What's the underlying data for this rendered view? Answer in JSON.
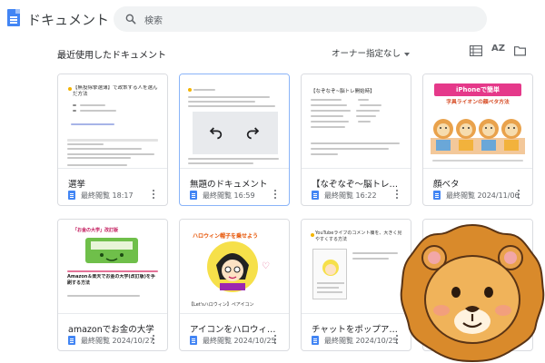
{
  "app": {
    "title": "ドキュメント"
  },
  "search": {
    "placeholder": "検索"
  },
  "section": {
    "title": "最近使用したドキュメント"
  },
  "filter": {
    "owner": "オーナー指定なし"
  },
  "toolbar": {
    "sort_label": "AZ"
  },
  "colors": {
    "accent": "#4285f4",
    "selected_border": "#8ab4f8",
    "text": "#202124",
    "muted": "#5f6368"
  },
  "documents": [
    {
      "title": "選挙",
      "date": "最終閲覧 18:17",
      "thumb_title": "【無投除挙選薄】で政策する人を選んだ方法"
    },
    {
      "title": "無題のドキュメント",
      "date": "最終閲覧 16:59",
      "thumb_title": "無題のドキュメント"
    },
    {
      "title": "【なぞなぞ〜脳トレ開始時…",
      "date": "最終閲覧 16:22",
      "thumb_title": "【なぞなぞ~脳トレ開始時】"
    },
    {
      "title": "顔ベタ",
      "date": "最終閲覧 2024/11/06",
      "thumb_title": "iPhoneで簡単",
      "thumb_subtitle": "字具ライオンの顔ベタ方法"
    },
    {
      "title": "amazonでお金の大学",
      "date": "最終閲覧 2024/10/27",
      "thumb_title": "「お金の大学」改訂版",
      "thumb_caption": "Amazon＆楽天でお金の大学(改訂版)を手刷する方法"
    },
    {
      "title": "アイコンをハロウィンに",
      "date": "最終閲覧 2024/10/25",
      "thumb_title": "ハロウィン帽子を乗せよう",
      "thumb_caption": "【Let'sハロウィン】ペアイコン"
    },
    {
      "title": "チャットをポップアウト",
      "date": "最終閲覧 2024/10/25",
      "thumb_title": "YouTubeライブのコメント欄を、大きく見やすくする方法"
    },
    {
      "title": "",
      "date": "",
      "thumb_title": ""
    }
  ]
}
